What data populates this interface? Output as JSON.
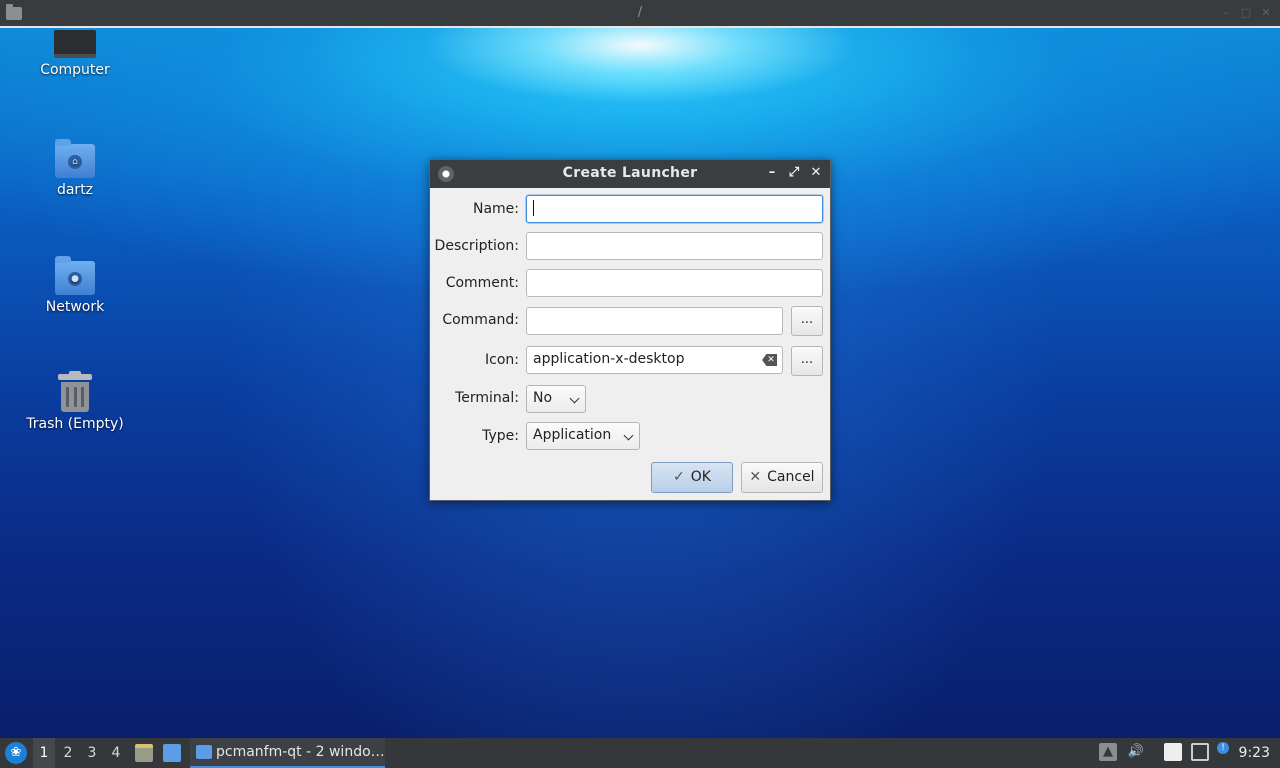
{
  "topbar": {
    "path": "/"
  },
  "desktop_icons": [
    {
      "label": "Computer"
    },
    {
      "label": "dartz"
    },
    {
      "label": "Network"
    },
    {
      "label": "Trash (Empty)"
    }
  ],
  "dialog": {
    "title": "Create Launcher",
    "fields": {
      "name_label": "Name:",
      "name_value": "",
      "description_label": "Description:",
      "description_value": "",
      "comment_label": "Comment:",
      "comment_value": "",
      "command_label": "Command:",
      "command_value": "",
      "icon_label": "Icon:",
      "icon_value": "application-x-desktop",
      "terminal_label": "Terminal:",
      "terminal_value": "No",
      "type_label": "Type:",
      "type_value": "Application",
      "browse_label": "..."
    },
    "buttons": {
      "ok": "OK",
      "cancel": "Cancel"
    }
  },
  "taskbar": {
    "workspaces": [
      "1",
      "2",
      "3",
      "4"
    ],
    "active_workspace": "1",
    "task_label": "pcmanfm-qt - 2 windo…",
    "clock": "9:23"
  },
  "colors": {
    "accent": "#3d8ee0",
    "titlebar": "#3b3e41",
    "taskbar": "#35383b"
  }
}
